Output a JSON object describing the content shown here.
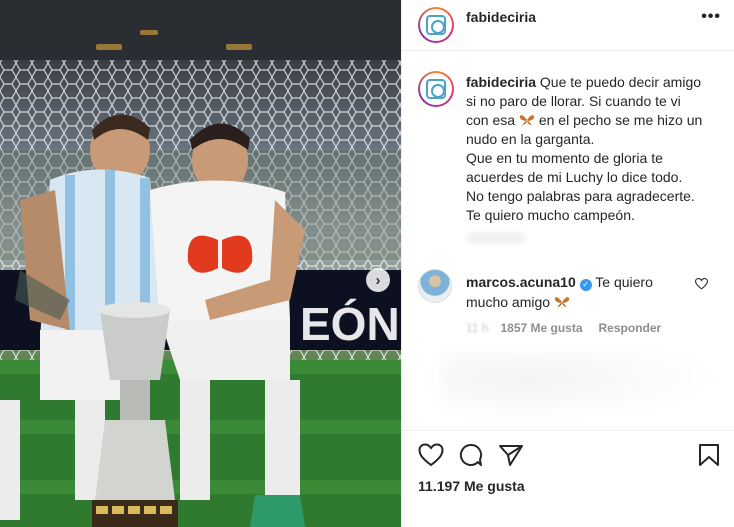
{
  "post": {
    "author": "fabideciria",
    "more_icon": "•••",
    "next_icon": "›"
  },
  "caption": {
    "username": "fabideciria",
    "line1": "Que te puedo decir amigo",
    "line2": "si no paro de llorar. Si cuando te vi",
    "line3a": "con esa",
    "line3b": "en el pecho se me hizo un",
    "line4": "nudo en la garganta.",
    "line5": "Que en tu momento de gloria te",
    "line6": "acuerdes de mi Luchy lo dice todo.",
    "line7": "No tengo palabras para agradecerte.",
    "line8": "Te quiero mucho campeón."
  },
  "comment": {
    "username": "marcos.acuna10",
    "text1": "Te quiero",
    "text2": "mucho amigo",
    "time": "11 h",
    "likes": "1857 Me gusta",
    "reply": "Responder"
  },
  "likes": "11.197 Me gusta",
  "colors": {
    "accent": "#3897f0",
    "text": "#262626",
    "muted": "#8e8e8e",
    "butterfly": "#c9742a"
  },
  "icons": [
    "more-icon",
    "next-arrow-icon",
    "butterfly-icon",
    "verified-icon",
    "heart-icon",
    "comment-icon",
    "share-icon",
    "bookmark-icon"
  ]
}
